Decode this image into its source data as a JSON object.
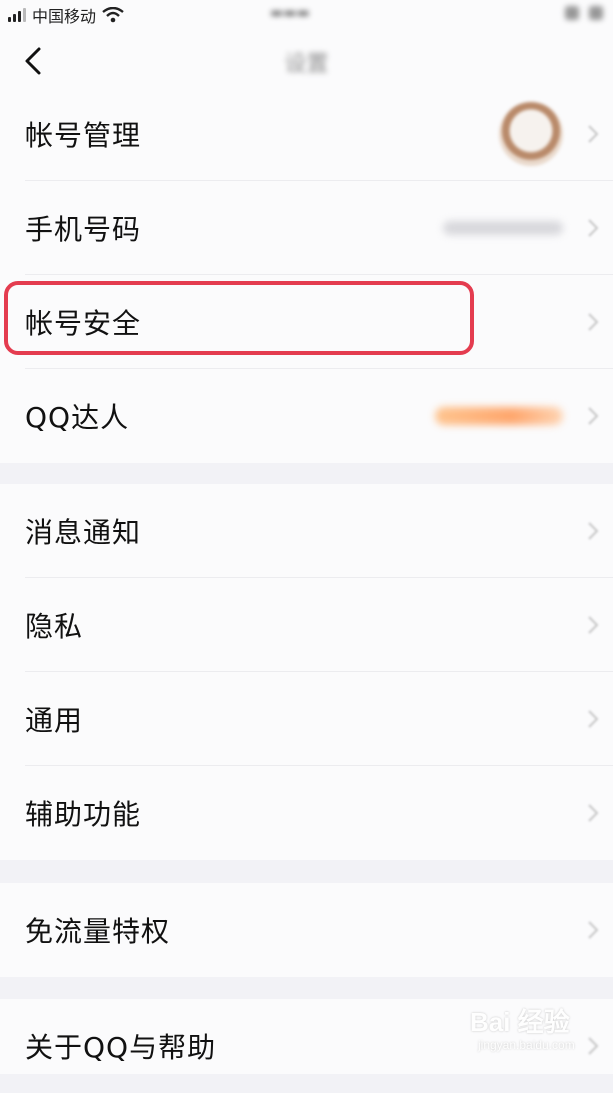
{
  "status_bar": {
    "carrier": "中国移动"
  },
  "nav": {
    "back_icon": "chevron-left-icon",
    "title": "设置"
  },
  "groups": [
    {
      "items": [
        {
          "label": "帐号管理",
          "accessory": "avatar"
        },
        {
          "label": "手机号码",
          "accessory": "masked-phone-number"
        },
        {
          "label": "帐号安全",
          "accessory": "chevron",
          "highlighted": true
        },
        {
          "label": "QQ达人",
          "accessory": "qq-expert-badge"
        }
      ]
    },
    {
      "items": [
        {
          "label": "消息通知"
        },
        {
          "label": "隐私"
        },
        {
          "label": "通用"
        },
        {
          "label": "辅助功能"
        }
      ]
    },
    {
      "items": [
        {
          "label": "免流量特权"
        }
      ]
    },
    {
      "items": [
        {
          "label": "关于QQ与帮助"
        }
      ]
    }
  ],
  "highlight_color": "#e43c4f",
  "watermark": {
    "main": "Bai 经验",
    "sub": "jingyan.baidu.com"
  }
}
